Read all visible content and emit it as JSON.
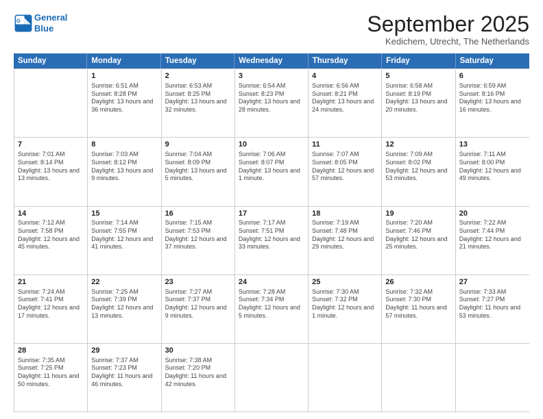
{
  "header": {
    "logo_line1": "General",
    "logo_line2": "Blue",
    "month_title": "September 2025",
    "location": "Kedichem, Utrecht, The Netherlands"
  },
  "weekdays": [
    "Sunday",
    "Monday",
    "Tuesday",
    "Wednesday",
    "Thursday",
    "Friday",
    "Saturday"
  ],
  "weeks": [
    [
      {
        "day": "",
        "sunrise": "",
        "sunset": "",
        "daylight": ""
      },
      {
        "day": "1",
        "sunrise": "Sunrise: 6:51 AM",
        "sunset": "Sunset: 8:28 PM",
        "daylight": "Daylight: 13 hours and 36 minutes."
      },
      {
        "day": "2",
        "sunrise": "Sunrise: 6:53 AM",
        "sunset": "Sunset: 8:25 PM",
        "daylight": "Daylight: 13 hours and 32 minutes."
      },
      {
        "day": "3",
        "sunrise": "Sunrise: 6:54 AM",
        "sunset": "Sunset: 8:23 PM",
        "daylight": "Daylight: 13 hours and 28 minutes."
      },
      {
        "day": "4",
        "sunrise": "Sunrise: 6:56 AM",
        "sunset": "Sunset: 8:21 PM",
        "daylight": "Daylight: 13 hours and 24 minutes."
      },
      {
        "day": "5",
        "sunrise": "Sunrise: 6:58 AM",
        "sunset": "Sunset: 8:19 PM",
        "daylight": "Daylight: 13 hours and 20 minutes."
      },
      {
        "day": "6",
        "sunrise": "Sunrise: 6:59 AM",
        "sunset": "Sunset: 8:16 PM",
        "daylight": "Daylight: 13 hours and 16 minutes."
      }
    ],
    [
      {
        "day": "7",
        "sunrise": "Sunrise: 7:01 AM",
        "sunset": "Sunset: 8:14 PM",
        "daylight": "Daylight: 13 hours and 13 minutes."
      },
      {
        "day": "8",
        "sunrise": "Sunrise: 7:03 AM",
        "sunset": "Sunset: 8:12 PM",
        "daylight": "Daylight: 13 hours and 9 minutes."
      },
      {
        "day": "9",
        "sunrise": "Sunrise: 7:04 AM",
        "sunset": "Sunset: 8:09 PM",
        "daylight": "Daylight: 13 hours and 5 minutes."
      },
      {
        "day": "10",
        "sunrise": "Sunrise: 7:06 AM",
        "sunset": "Sunset: 8:07 PM",
        "daylight": "Daylight: 13 hours and 1 minute."
      },
      {
        "day": "11",
        "sunrise": "Sunrise: 7:07 AM",
        "sunset": "Sunset: 8:05 PM",
        "daylight": "Daylight: 12 hours and 57 minutes."
      },
      {
        "day": "12",
        "sunrise": "Sunrise: 7:09 AM",
        "sunset": "Sunset: 8:02 PM",
        "daylight": "Daylight: 12 hours and 53 minutes."
      },
      {
        "day": "13",
        "sunrise": "Sunrise: 7:11 AM",
        "sunset": "Sunset: 8:00 PM",
        "daylight": "Daylight: 12 hours and 49 minutes."
      }
    ],
    [
      {
        "day": "14",
        "sunrise": "Sunrise: 7:12 AM",
        "sunset": "Sunset: 7:58 PM",
        "daylight": "Daylight: 12 hours and 45 minutes."
      },
      {
        "day": "15",
        "sunrise": "Sunrise: 7:14 AM",
        "sunset": "Sunset: 7:55 PM",
        "daylight": "Daylight: 12 hours and 41 minutes."
      },
      {
        "day": "16",
        "sunrise": "Sunrise: 7:15 AM",
        "sunset": "Sunset: 7:53 PM",
        "daylight": "Daylight: 12 hours and 37 minutes."
      },
      {
        "day": "17",
        "sunrise": "Sunrise: 7:17 AM",
        "sunset": "Sunset: 7:51 PM",
        "daylight": "Daylight: 12 hours and 33 minutes."
      },
      {
        "day": "18",
        "sunrise": "Sunrise: 7:19 AM",
        "sunset": "Sunset: 7:48 PM",
        "daylight": "Daylight: 12 hours and 29 minutes."
      },
      {
        "day": "19",
        "sunrise": "Sunrise: 7:20 AM",
        "sunset": "Sunset: 7:46 PM",
        "daylight": "Daylight: 12 hours and 25 minutes."
      },
      {
        "day": "20",
        "sunrise": "Sunrise: 7:22 AM",
        "sunset": "Sunset: 7:44 PM",
        "daylight": "Daylight: 12 hours and 21 minutes."
      }
    ],
    [
      {
        "day": "21",
        "sunrise": "Sunrise: 7:24 AM",
        "sunset": "Sunset: 7:41 PM",
        "daylight": "Daylight: 12 hours and 17 minutes."
      },
      {
        "day": "22",
        "sunrise": "Sunrise: 7:25 AM",
        "sunset": "Sunset: 7:39 PM",
        "daylight": "Daylight: 12 hours and 13 minutes."
      },
      {
        "day": "23",
        "sunrise": "Sunrise: 7:27 AM",
        "sunset": "Sunset: 7:37 PM",
        "daylight": "Daylight: 12 hours and 9 minutes."
      },
      {
        "day": "24",
        "sunrise": "Sunrise: 7:28 AM",
        "sunset": "Sunset: 7:34 PM",
        "daylight": "Daylight: 12 hours and 5 minutes."
      },
      {
        "day": "25",
        "sunrise": "Sunrise: 7:30 AM",
        "sunset": "Sunset: 7:32 PM",
        "daylight": "Daylight: 12 hours and 1 minute."
      },
      {
        "day": "26",
        "sunrise": "Sunrise: 7:32 AM",
        "sunset": "Sunset: 7:30 PM",
        "daylight": "Daylight: 11 hours and 57 minutes."
      },
      {
        "day": "27",
        "sunrise": "Sunrise: 7:33 AM",
        "sunset": "Sunset: 7:27 PM",
        "daylight": "Daylight: 11 hours and 53 minutes."
      }
    ],
    [
      {
        "day": "28",
        "sunrise": "Sunrise: 7:35 AM",
        "sunset": "Sunset: 7:25 PM",
        "daylight": "Daylight: 11 hours and 50 minutes."
      },
      {
        "day": "29",
        "sunrise": "Sunrise: 7:37 AM",
        "sunset": "Sunset: 7:23 PM",
        "daylight": "Daylight: 11 hours and 46 minutes."
      },
      {
        "day": "30",
        "sunrise": "Sunrise: 7:38 AM",
        "sunset": "Sunset: 7:20 PM",
        "daylight": "Daylight: 11 hours and 42 minutes."
      },
      {
        "day": "",
        "sunrise": "",
        "sunset": "",
        "daylight": ""
      },
      {
        "day": "",
        "sunrise": "",
        "sunset": "",
        "daylight": ""
      },
      {
        "day": "",
        "sunrise": "",
        "sunset": "",
        "daylight": ""
      },
      {
        "day": "",
        "sunrise": "",
        "sunset": "",
        "daylight": ""
      }
    ]
  ]
}
